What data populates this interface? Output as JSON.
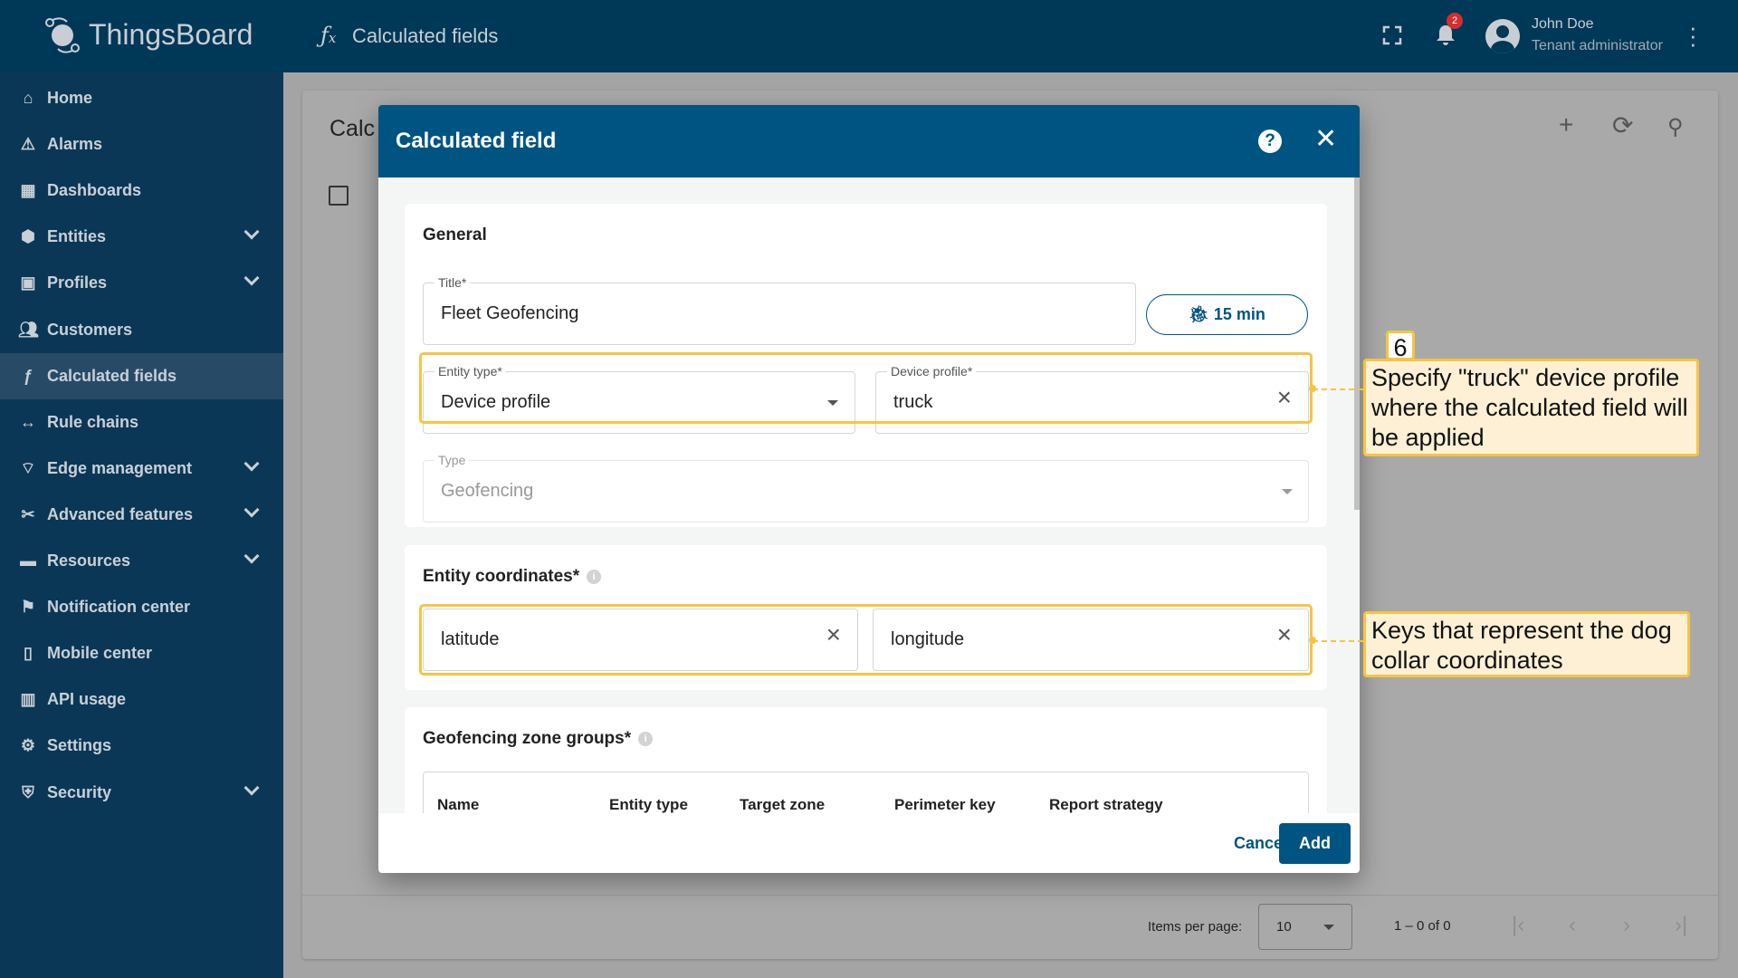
{
  "app": {
    "name": "ThingsBoard",
    "page_title": "Calculated fields"
  },
  "header": {
    "notifications_count": "2",
    "user_name": "John Doe",
    "user_role": "Tenant administrator"
  },
  "sidebar": {
    "items": [
      {
        "label": "Home",
        "icon": "home-icon",
        "chevron": false
      },
      {
        "label": "Alarms",
        "icon": "alarm-icon",
        "chevron": false
      },
      {
        "label": "Dashboards",
        "icon": "dashboard-icon",
        "chevron": false
      },
      {
        "label": "Entities",
        "icon": "entities-icon",
        "chevron": true
      },
      {
        "label": "Profiles",
        "icon": "profiles-icon",
        "chevron": true
      },
      {
        "label": "Customers",
        "icon": "customers-icon",
        "chevron": false
      },
      {
        "label": "Calculated fields",
        "icon": "fx-icon",
        "chevron": false,
        "active": true
      },
      {
        "label": "Rule chains",
        "icon": "rule-chain-icon",
        "chevron": false
      },
      {
        "label": "Edge management",
        "icon": "edge-icon",
        "chevron": true
      },
      {
        "label": "Advanced features",
        "icon": "tools-icon",
        "chevron": true
      },
      {
        "label": "Resources",
        "icon": "folder-icon",
        "chevron": true
      },
      {
        "label": "Notification center",
        "icon": "notification-icon",
        "chevron": false
      },
      {
        "label": "Mobile center",
        "icon": "mobile-icon",
        "chevron": false
      },
      {
        "label": "API usage",
        "icon": "chart-icon",
        "chevron": false
      },
      {
        "label": "Settings",
        "icon": "gear-icon",
        "chevron": false
      },
      {
        "label": "Security",
        "icon": "shield-icon",
        "chevron": true
      }
    ]
  },
  "card": {
    "title": "Calc",
    "pagination": {
      "items_per_page_label": "Items per page:",
      "items_per_page": "10",
      "range": "1 – 0 of 0"
    }
  },
  "dialog": {
    "title": "Calculated field",
    "general": {
      "heading": "General",
      "title_label": "Title*",
      "title_value": "Fleet Geofencing",
      "debug_button": "15 min",
      "entity_type_label": "Entity type*",
      "entity_type_value": "Device profile",
      "device_profile_label": "Device profile*",
      "device_profile_value": "truck",
      "type_label": "Type",
      "type_value": "Geofencing"
    },
    "coordinates": {
      "heading": "Entity coordinates*",
      "latitude": "latitude",
      "longitude": "longitude"
    },
    "zones": {
      "heading": "Geofencing zone groups*",
      "columns": [
        "Name",
        "Entity type",
        "Target zone",
        "Perimeter key",
        "Report strategy"
      ]
    },
    "cancel": "Cancel",
    "add": "Add"
  },
  "annotations": [
    {
      "step": "6",
      "text": "Specify \"truck\" device profile where the calculated field will be applied"
    },
    {
      "text": "Keys that represent the dog collar coordinates"
    }
  ],
  "colors": {
    "header": "#003858",
    "dialog_header": "#005482",
    "highlight": "#f7c443",
    "callout_bg": "#fdf0d4"
  }
}
